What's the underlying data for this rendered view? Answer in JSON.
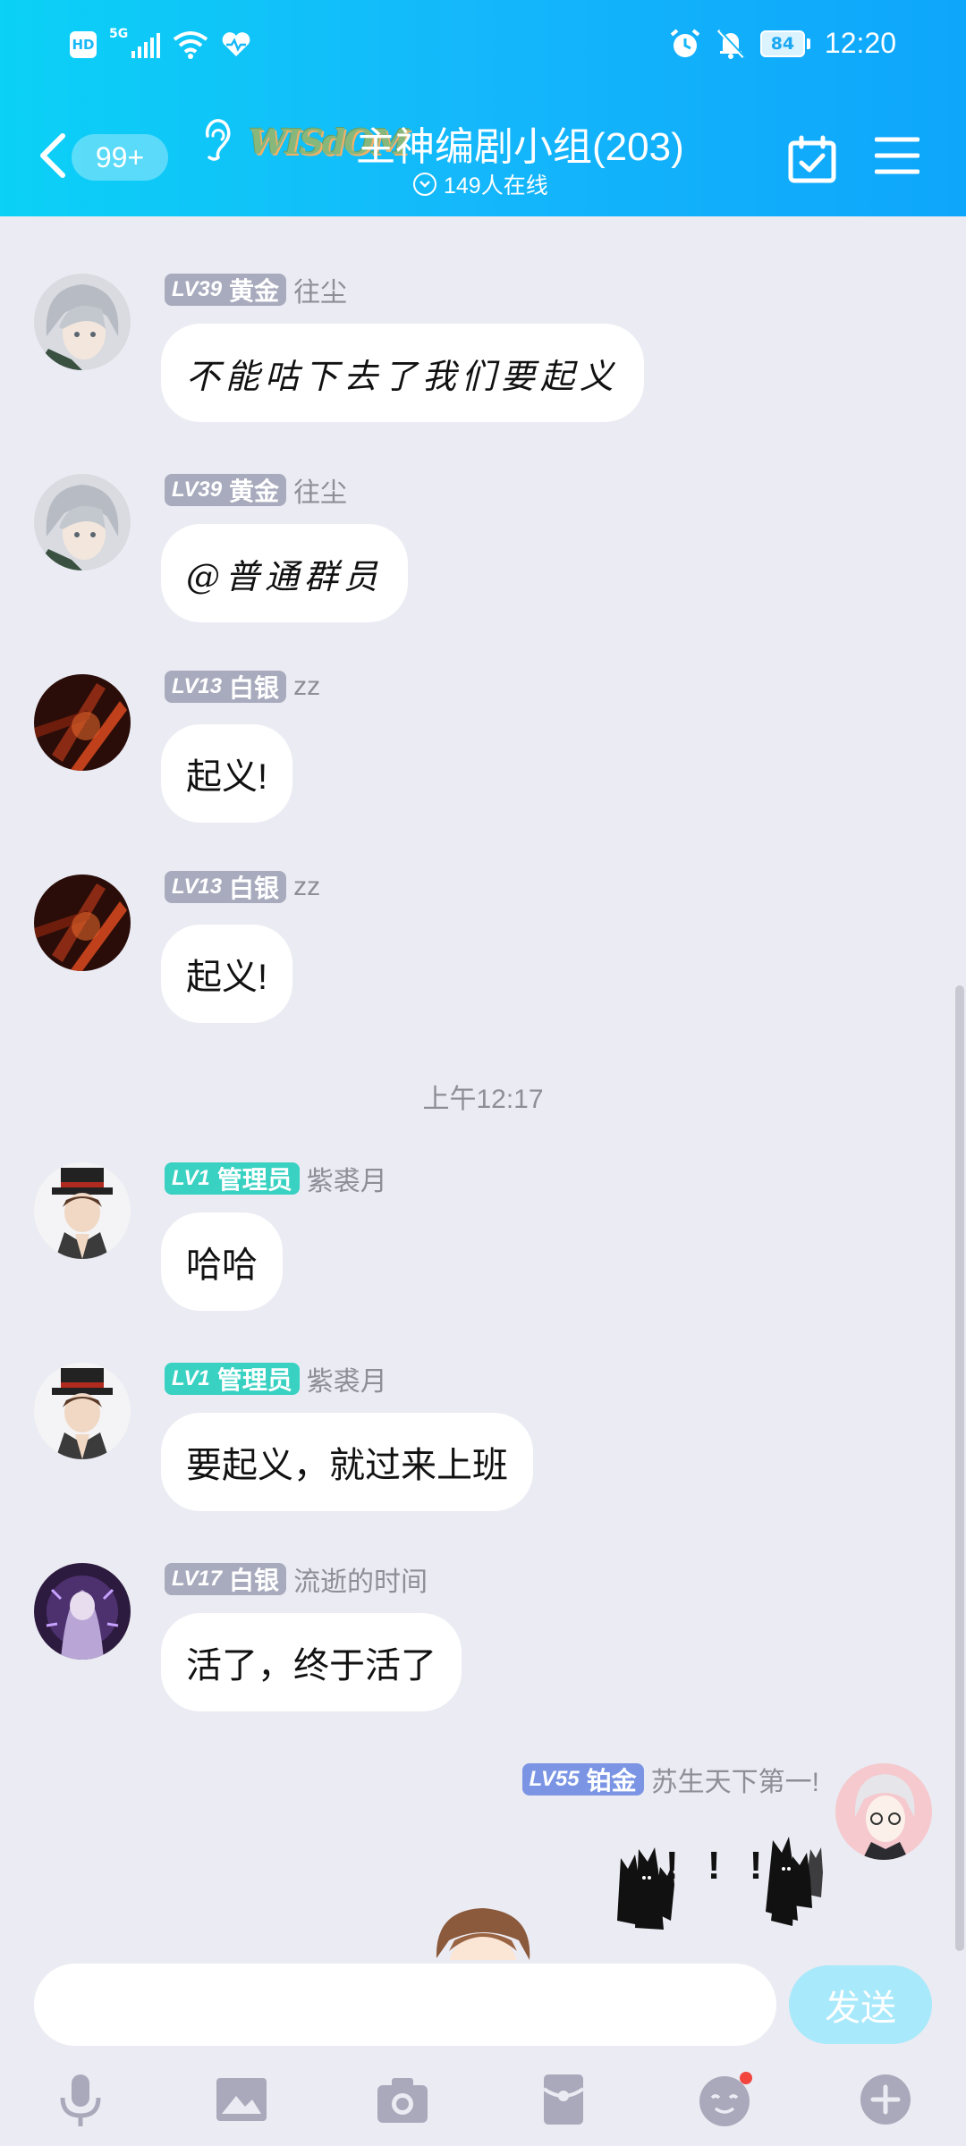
{
  "status_bar": {
    "hd": "HD",
    "network": "5G",
    "battery": "84",
    "time": "12:20"
  },
  "header": {
    "unread": "99+",
    "logo_text": "WISdOM",
    "title": "主神编剧小组(203)",
    "online": "149人在线"
  },
  "messages": [
    {
      "level": "LV39",
      "rank": "黄金",
      "nickname": "往尘",
      "text": "不能咕下去了我们要起义"
    },
    {
      "level": "LV39",
      "rank": "黄金",
      "nickname": "往尘",
      "text": "@普通群员"
    },
    {
      "level": "LV13",
      "rank": "白银",
      "nickname": "zz",
      "text": "起义!"
    },
    {
      "level": "LV13",
      "rank": "白银",
      "nickname": "zz",
      "text": "起义!"
    },
    {
      "level": "LV1",
      "rank": "管理员",
      "nickname": "紫裘月",
      "text": "哈哈"
    },
    {
      "level": "LV1",
      "rank": "管理员",
      "nickname": "紫裘月",
      "text": "要起义，就过来上班"
    },
    {
      "level": "LV17",
      "rank": "白银",
      "nickname": "流逝的时间",
      "text": "活了，终于活了"
    },
    {
      "level": "LV55",
      "rank": "铂金",
      "nickname": "苏生天下第一!",
      "text": "! ! !"
    }
  ],
  "timestamp": "上午12:17",
  "input": {
    "send_label": "发送"
  },
  "toolbar": [
    "microphone-icon",
    "image-icon",
    "camera-icon",
    "red-packet-icon",
    "emoji-icon",
    "plus-icon"
  ],
  "colors": {
    "header_gradient_start": "#0bd1f6",
    "header_gradient_end": "#0ea6fb",
    "chat_background": "#ebebf3",
    "admin_badge": "#39d1c2",
    "member_badge": "#a8abbd",
    "platinum_badge": "#7b95e4",
    "send_button": "#a8e9fb"
  }
}
